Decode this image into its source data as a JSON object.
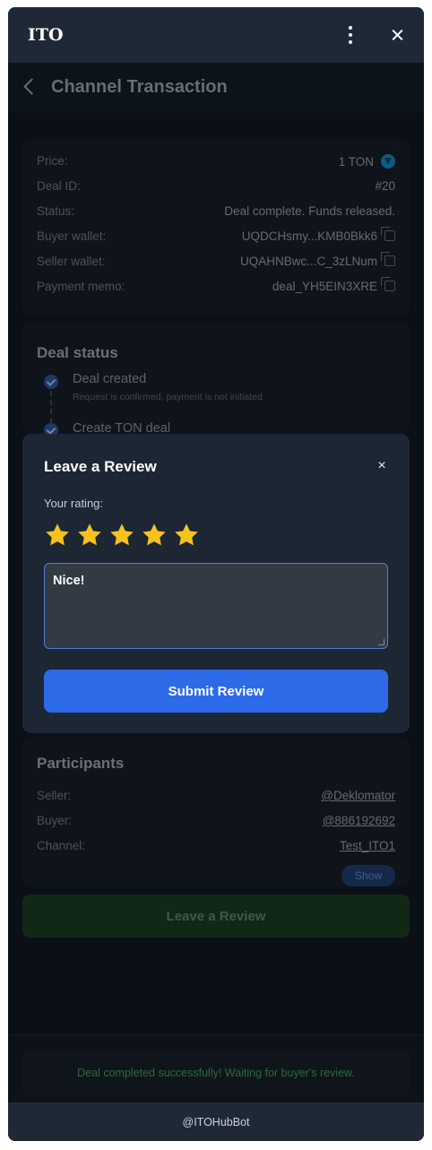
{
  "window": {
    "title": "ITO"
  },
  "header": {
    "title": "Channel Transaction"
  },
  "details": {
    "price_label": "Price:",
    "price_value": "1 TON",
    "deal_id_label": "Deal ID:",
    "deal_id_value": "#20",
    "status_label": "Status:",
    "status_value": "Deal complete. Funds released.",
    "buyer_wallet_label": "Buyer wallet:",
    "buyer_wallet_value": "UQDCHsmy...KMB0Bkk6",
    "seller_wallet_label": "Seller wallet:",
    "seller_wallet_value": "UQAHNBwc...C_3zLNum",
    "memo_label": "Payment memo:",
    "memo_value": "deal_YH5EIN3XRE"
  },
  "deal_status": {
    "title": "Deal status",
    "steps": [
      {
        "title": "Deal created",
        "subtitle": "Request is confirmed, payment is not initiated"
      },
      {
        "title": "Create TON deal",
        "subtitle": ""
      }
    ]
  },
  "participants": {
    "title": "Participants",
    "seller_label": "Seller:",
    "seller_value": "@Deklomator",
    "buyer_label": "Buyer:",
    "buyer_value": "@886192692",
    "channel_label": "Channel:",
    "channel_value": "Test_ITO1",
    "show_label": "Show"
  },
  "leave_review_label": "Leave a Review",
  "footer_status": "Deal completed successfully! Waiting for buyer's review.",
  "bot_name": "@ITOHubBot",
  "modal": {
    "title": "Leave a Review",
    "close": "×",
    "rating_label": "Your rating:",
    "rating": 5,
    "rating_max": 5,
    "review_text": "Nice!",
    "submit_label": "Submit Review"
  },
  "colors": {
    "accent": "#2c6ae8",
    "star": "#f6c21c",
    "success": "#2d6a3a"
  }
}
